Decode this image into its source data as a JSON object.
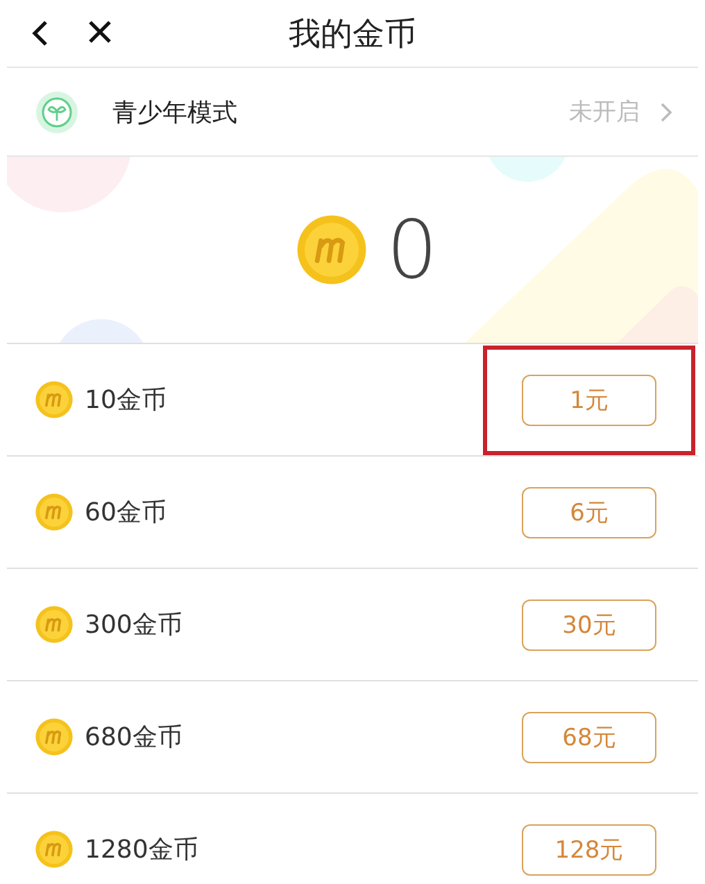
{
  "header": {
    "title": "我的金币"
  },
  "teen_mode": {
    "label": "青少年模式",
    "status": "未开启"
  },
  "balance": {
    "amount": "0"
  },
  "packages": [
    {
      "coins": "10金币",
      "price": "1元",
      "highlighted": true
    },
    {
      "coins": "60金币",
      "price": "6元",
      "highlighted": false
    },
    {
      "coins": "300金币",
      "price": "30元",
      "highlighted": false
    },
    {
      "coins": "680金币",
      "price": "68元",
      "highlighted": false
    },
    {
      "coins": "1280金币",
      "price": "128元",
      "highlighted": false
    }
  ]
}
